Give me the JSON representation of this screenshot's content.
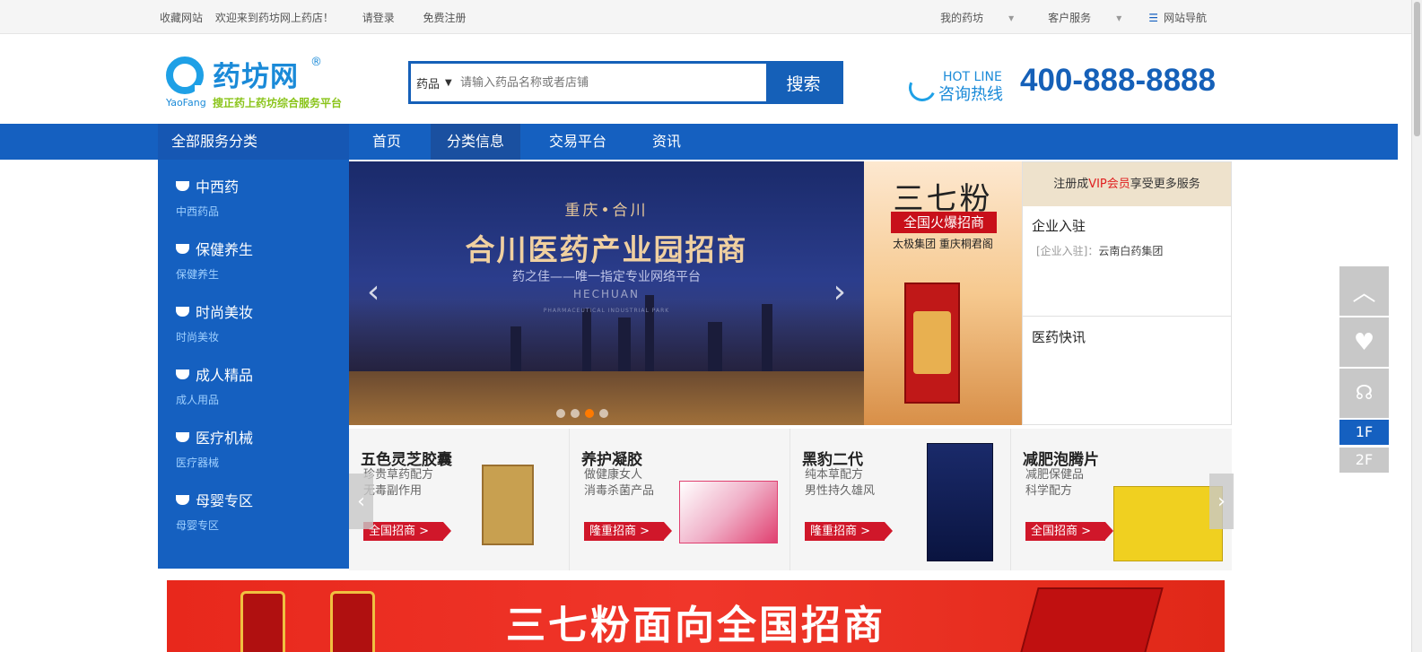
{
  "topbar": {
    "bookmark": "收藏网站",
    "welcome": "欢迎来到药坊网上药店！",
    "login": "请登录",
    "register": "免费注册",
    "my_pharmacy": "我的药坊",
    "customer_service": "客户服务",
    "site_nav": "网站导航"
  },
  "logo": {
    "name": "药坊网",
    "reg": "®",
    "en": "YaoFang",
    "slogan": "搜正药上药坊综合服务平台"
  },
  "search": {
    "category": "药品",
    "placeholder": "请输入药品名称或者店铺",
    "button": "搜索"
  },
  "hotline": {
    "en": "HOT LINE",
    "cn": "咨询热线",
    "phone": "400-888-8888"
  },
  "nav": {
    "all_categories": "全部服务分类",
    "items": [
      "首页",
      "分类信息",
      "交易平台",
      "资讯"
    ]
  },
  "categories": [
    {
      "title": "中西药",
      "sub": "中西药品"
    },
    {
      "title": "保健养生",
      "sub": "保健养生"
    },
    {
      "title": "时尚美妆",
      "sub": "时尚美妆"
    },
    {
      "title": "成人精品",
      "sub": "成人用品"
    },
    {
      "title": "医疗机械",
      "sub": "医疗器械"
    },
    {
      "title": "母婴专区",
      "sub": "母婴专区"
    }
  ],
  "banner": {
    "line1": "重庆•合川",
    "line2": "合川医药产业园招商",
    "line3": "药之佳——唯一指定专业网络平台",
    "line4": "HECHUAN",
    "line5": "PHARMACEUTICAL INDUSTRIAL PARK",
    "prev": "‹",
    "next": "›",
    "slides": 4,
    "active_slide": 2
  },
  "promo": {
    "title": "三七粉",
    "badge": "全国火爆招商",
    "sub": "太极集团 重庆桐君阁"
  },
  "vip": {
    "head_pre": "注册成",
    "head_red": "VIP会员",
    "head_post": "享受更多服务",
    "enterprise_title": "企业入驻",
    "enterprise_tag": "[企业入驻]：",
    "enterprise_name": "云南白药集团",
    "news_title": "医药快讯"
  },
  "products": [
    {
      "title": "五色灵芝胶囊",
      "desc1": "珍贵草药配方",
      "desc2": "无毒副作用",
      "button": "全国招商 >",
      "color": "#c8a050"
    },
    {
      "title": "养护凝胶",
      "desc1": "做健康女人",
      "desc2": "消毒杀菌产品",
      "button": "隆重招商 >",
      "color": "#e04070"
    },
    {
      "title": "黑豹二代",
      "desc1": "纯本草配方",
      "desc2": "男性持久雄风",
      "button": "隆重招商 >",
      "color": "#1a2a6a"
    },
    {
      "title": "减肥泡腾片",
      "desc1": "减肥保健品",
      "desc2": "科学配方",
      "button": "全国招商 >",
      "color": "#f0d020"
    }
  ],
  "bottom_banner": {
    "title": "三七粉面向全国招商"
  },
  "sidebar_tools": {
    "floor1": "1F",
    "floor2": "2F"
  },
  "colors": {
    "brand_blue": "#1560c0",
    "logo_blue": "#1a8ad8",
    "slogan_green": "#8ac41a",
    "promo_red": "#d0172a"
  }
}
